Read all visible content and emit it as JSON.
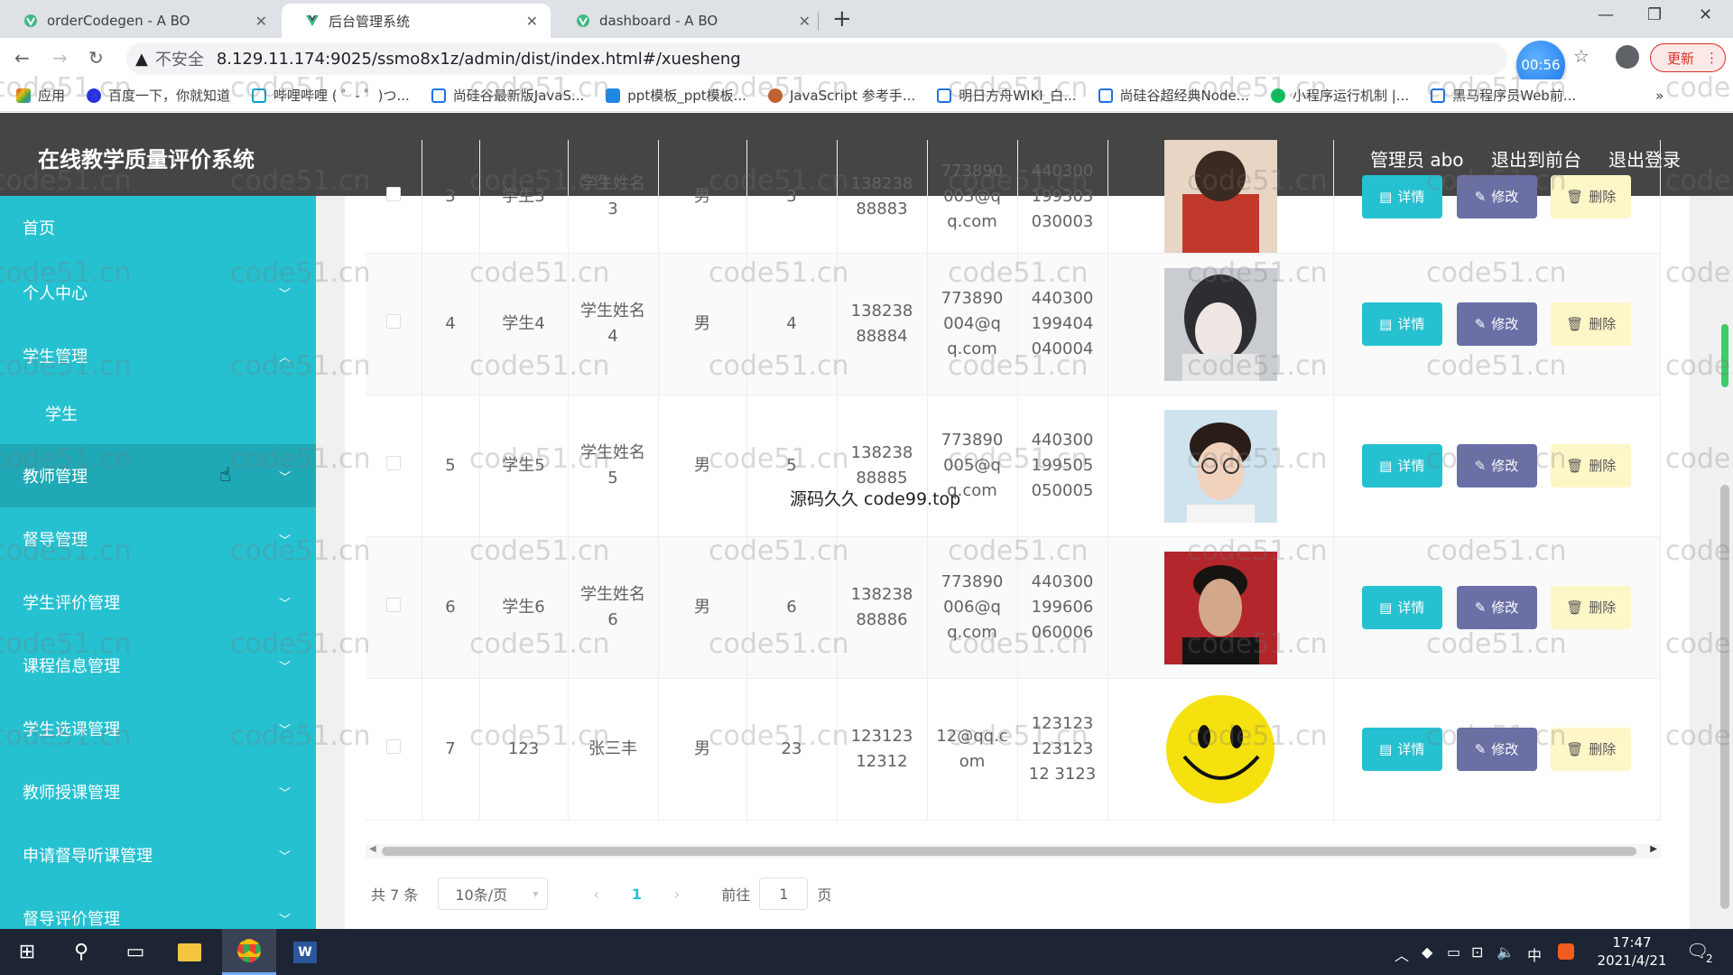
{
  "browser": {
    "tabs": [
      {
        "title": "orderCodegen - A BO",
        "active": false
      },
      {
        "title": "后台管理系统",
        "active": true
      },
      {
        "title": "dashboard - A BO",
        "active": false
      }
    ],
    "url_prefix": "不安全",
    "url": "8.129.11.174:9025/ssmo8x1z/admin/dist/index.html#/xuesheng",
    "timer": "00:56",
    "update_label": "更新",
    "bookmarks": [
      "应用",
      "百度一下，你就知道",
      "哔哩哔哩 ( ゜- ゜)つ...",
      "尚硅谷最新版JavaS...",
      "ppt模板_ppt模板...",
      "JavaScript 参考手...",
      "明日方舟WIKI_白...",
      "尚硅谷超经典Node...",
      "小程序运行机制 |...",
      "黑马程序员Web前..."
    ],
    "bookmark_overflow": "»"
  },
  "app": {
    "title": "在线教学质量评价系统",
    "header_links": [
      "管理员 abo",
      "退出到前台",
      "退出登录"
    ]
  },
  "sidebar": {
    "items": [
      {
        "label": "首页",
        "chevron": ""
      },
      {
        "label": "个人中心",
        "chevron": "﹀"
      },
      {
        "label": "学生管理",
        "chevron": "︿"
      },
      {
        "label": "学生",
        "chevron": ""
      },
      {
        "label": "教师管理",
        "chevron": "﹀"
      },
      {
        "label": "督导管理",
        "chevron": "﹀"
      },
      {
        "label": "学生评价管理",
        "chevron": "﹀"
      },
      {
        "label": "课程信息管理",
        "chevron": "﹀"
      },
      {
        "label": "学生选课管理",
        "chevron": "﹀"
      },
      {
        "label": "教师授课管理",
        "chevron": "﹀"
      },
      {
        "label": "申请督导听课管理",
        "chevron": "﹀"
      },
      {
        "label": "督导评价管理",
        "chevron": "﹀"
      }
    ]
  },
  "table": {
    "rows": [
      {
        "idx": "3",
        "account": "学生3",
        "name": "学生姓名3",
        "sex": "男",
        "age": "3",
        "phone": "13823888883",
        "email": "773890003@qq.com",
        "idcard": "440300199303030003",
        "photo": "photo-girl-red"
      },
      {
        "idx": "4",
        "account": "学生4",
        "name": "学生姓名4",
        "sex": "男",
        "age": "4",
        "phone": "13823888884",
        "email": "773890004@qq.com",
        "idcard": "440300199404040004",
        "photo": "photo-girl-bw"
      },
      {
        "idx": "5",
        "account": "学生5",
        "name": "学生姓名5",
        "sex": "男",
        "age": "5",
        "phone": "13823888885",
        "email": "773890005@qq.com",
        "idcard": "440300199505050005",
        "photo": "photo-boy-glasses"
      },
      {
        "idx": "6",
        "account": "学生6",
        "name": "学生姓名6",
        "sex": "男",
        "age": "6",
        "phone": "13823888886",
        "email": "773890006@qq.com",
        "idcard": "440300199606060006",
        "photo": "photo-man-red"
      },
      {
        "idx": "7",
        "account": "123",
        "name": "张三丰",
        "sex": "男",
        "age": "23",
        "phone": "12312312312",
        "email": "12@qq.com",
        "idcard": "12312312312312 3123",
        "photo": "smiley-face"
      }
    ],
    "row_actions": {
      "detail": "详情",
      "edit": "修改",
      "delete": "删除"
    }
  },
  "pagination": {
    "total": "共 7 条",
    "page_size": "10条/页",
    "prev": "‹",
    "current": "1",
    "next": "›",
    "goto_prefix": "前往",
    "goto_value": "1",
    "goto_suffix": "页"
  },
  "overlay_text": "源码久久 code99.top",
  "watermark_text": "code51.cn",
  "taskbar": {
    "ime": "中",
    "time": "17:47",
    "date": "2021/4/21",
    "notification_count": "2"
  },
  "colors": {
    "sidebar": "#26c1d1",
    "header": "#454545",
    "detail_button": "#26c1d1",
    "edit_button": "#6a6fa6",
    "delete_button": "#fdf6c6"
  }
}
